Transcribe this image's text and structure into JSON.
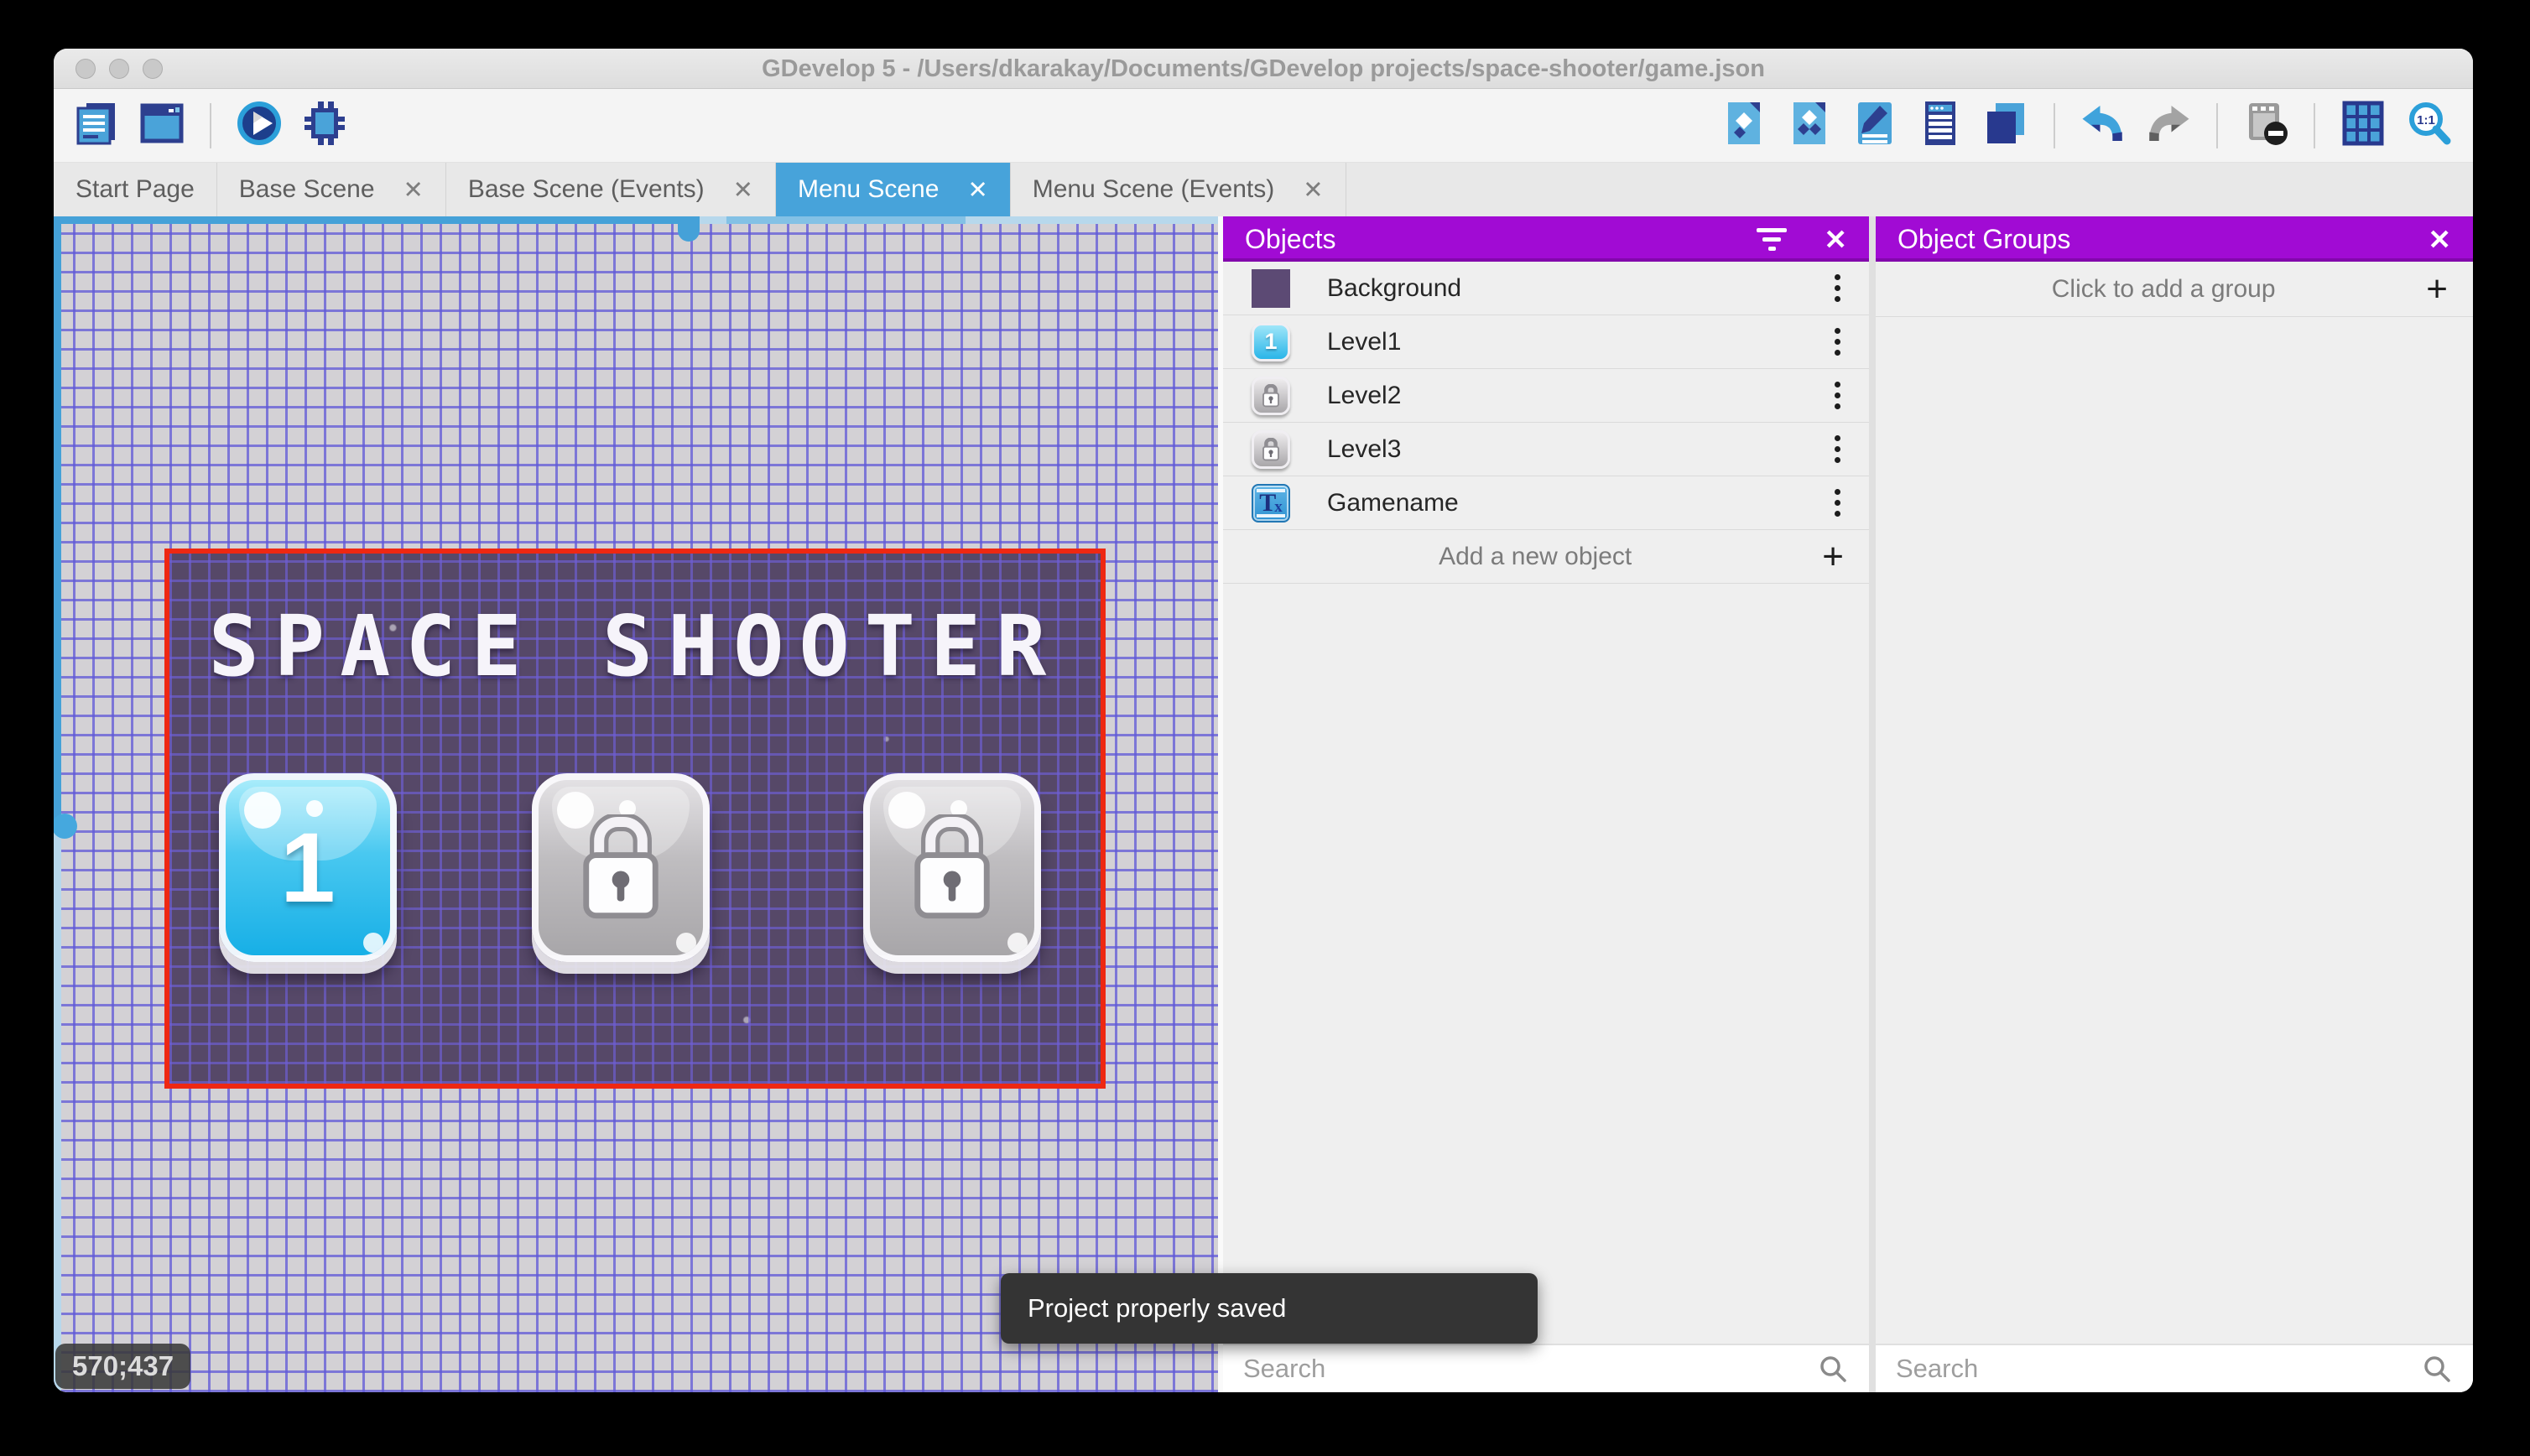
{
  "window": {
    "title": "GDevelop 5 - /Users/dkarakay/Documents/GDevelop projects/space-shooter/game.json"
  },
  "tabs": [
    {
      "label": "Start Page",
      "closable": false,
      "active": false
    },
    {
      "label": "Base Scene",
      "closable": true,
      "active": false
    },
    {
      "label": "Base Scene (Events)",
      "closable": true,
      "active": false
    },
    {
      "label": "Menu Scene",
      "closable": true,
      "active": true
    },
    {
      "label": "Menu Scene (Events)",
      "closable": true,
      "active": false
    }
  ],
  "canvas": {
    "coordinates": "570;437",
    "scene": {
      "title": "SPACE SHOOTER",
      "level_buttons": [
        {
          "label": "1",
          "state": "unlocked"
        },
        {
          "label": "",
          "state": "locked"
        },
        {
          "label": "",
          "state": "locked"
        }
      ]
    }
  },
  "objects_panel": {
    "title": "Objects",
    "items": [
      {
        "name": "Background",
        "thumb": "purple-square"
      },
      {
        "name": "Level1",
        "thumb": "blue-button",
        "badge": "1"
      },
      {
        "name": "Level2",
        "thumb": "locked-button"
      },
      {
        "name": "Level3",
        "thumb": "locked-button"
      },
      {
        "name": "Gamename",
        "thumb": "text-object",
        "badge_main": "T",
        "badge_sub": "x"
      }
    ],
    "add_label": "Add a new object",
    "search_placeholder": "Search"
  },
  "object_groups_panel": {
    "title": "Object Groups",
    "empty_label": "Click to add a group",
    "search_placeholder": "Search"
  },
  "snackbar": {
    "message": "Project properly saved"
  },
  "icons": {
    "close-icon": "✕",
    "add-icon": "+",
    "filter-icon": "three-bars-funnel",
    "search-icon": "magnifier",
    "kebab-icon": "three-vertical-dots",
    "undo-icon": "blue-arrow-left",
    "redo-icon": "gray-arrow-right"
  },
  "colors": {
    "accent_blue": "#47a3da",
    "panel_purple": "#a10bd4",
    "selection_red": "#ee2812",
    "scene_purple": "#564868",
    "toolbar_navy": "#2d3f8f"
  }
}
